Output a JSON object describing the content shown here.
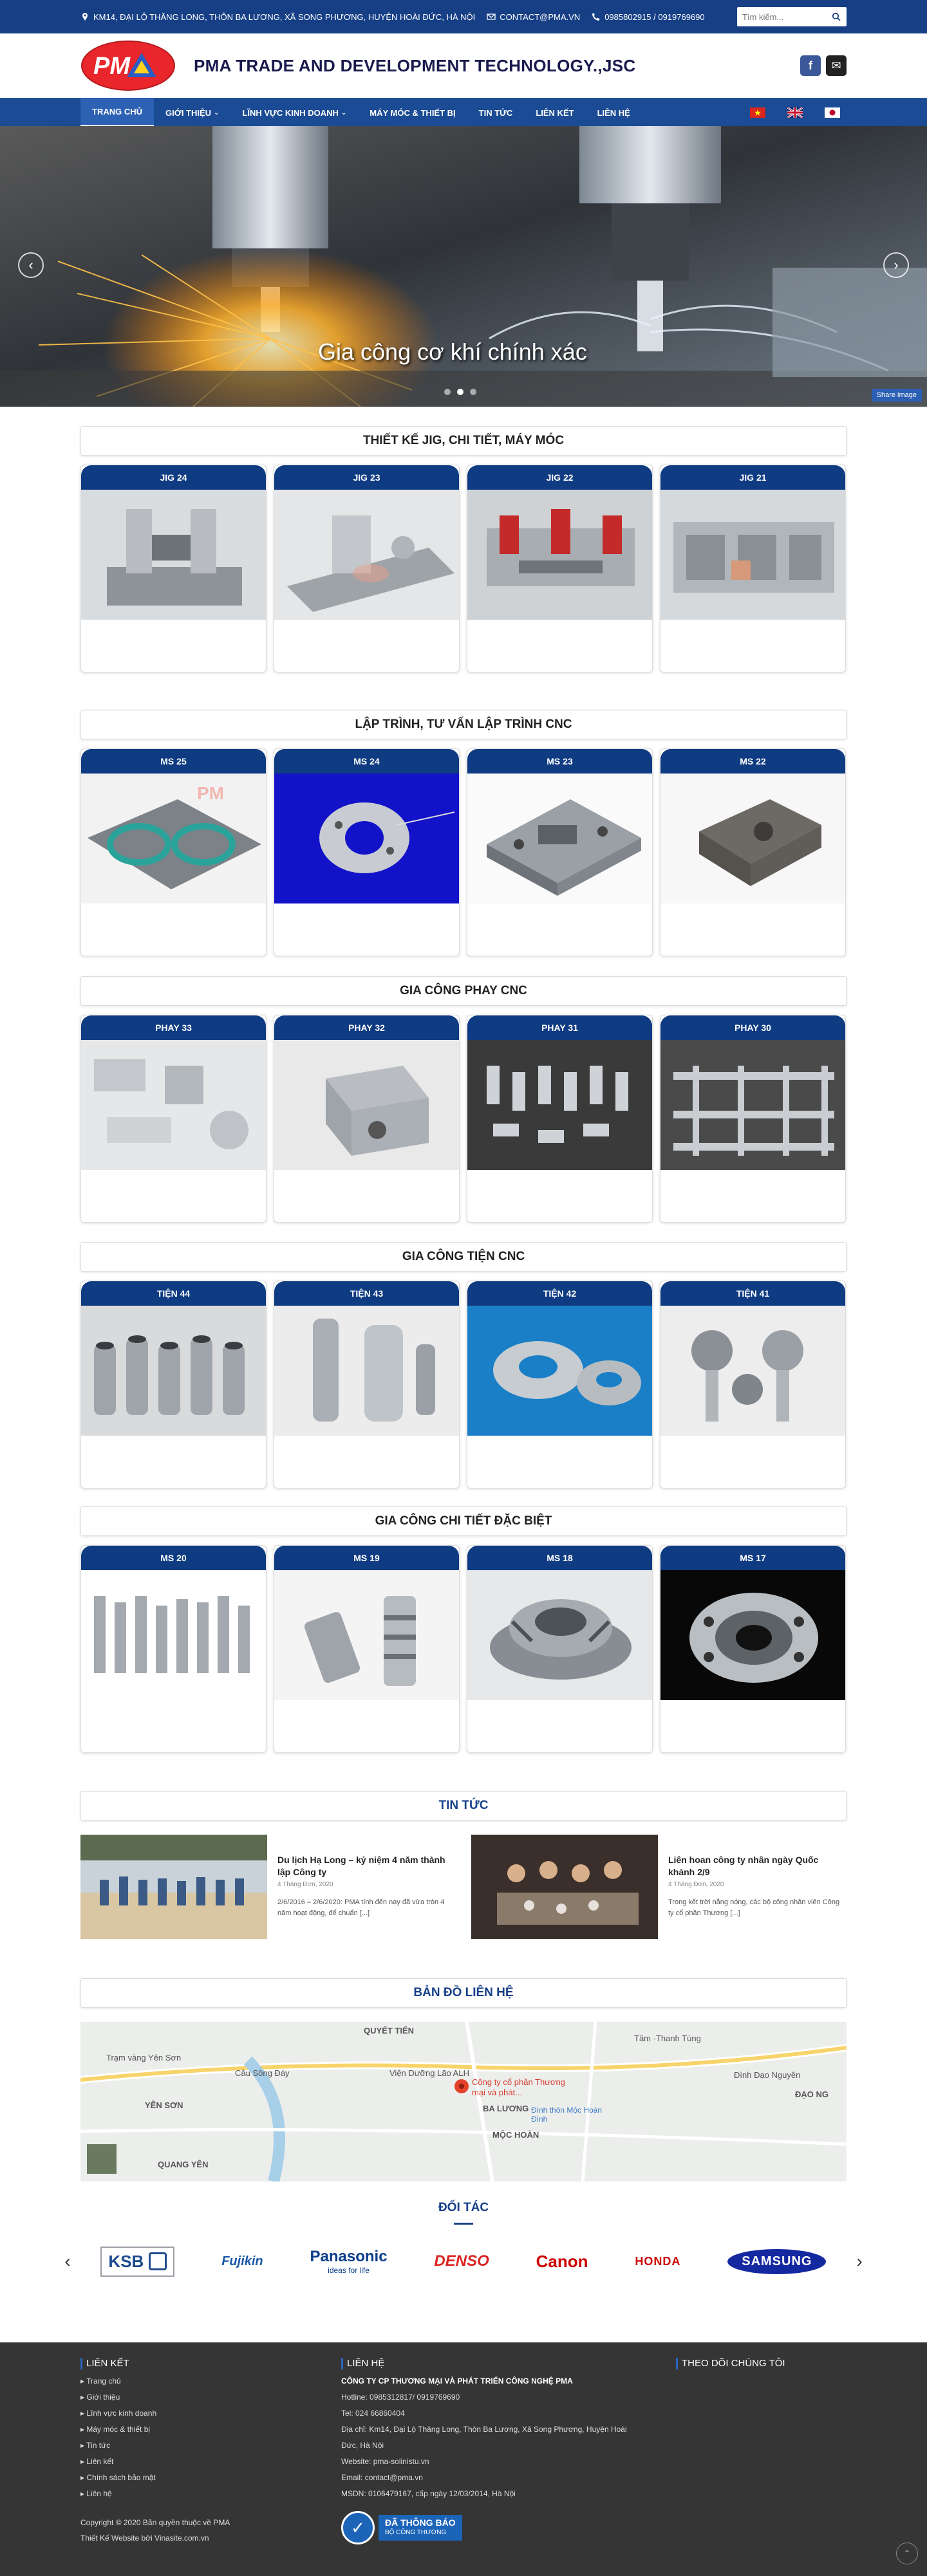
{
  "topbar": {
    "address": "KM14, ĐẠI LỘ THĂNG LONG, THÔN BA LƯƠNG, XÃ SONG PHƯƠNG, HUYỆN HOÀI ĐỨC, HÀ NỘI",
    "email": "CONTACT@PMA.VN",
    "phone": "0985802915 / 0919769690",
    "search_placeholder": "Tìm kiếm..."
  },
  "header": {
    "logo_text": "PMA",
    "company": "PMA TRADE AND DEVELOPMENT TECHNOLOGY.,JSC",
    "social": [
      "f",
      "✉"
    ]
  },
  "nav": {
    "items": [
      "TRANG CHỦ",
      "GIỚI THIỆU",
      "LĨNH VỰC KINH DOANH",
      "MÁY MÓC & THIẾT BỊ",
      "TIN TỨC",
      "LIÊN KẾT",
      "LIÊN HỆ"
    ]
  },
  "slider": {
    "caption": "Gia công cơ khí chính xác",
    "share": "Share image",
    "active_dot": 1,
    "dot_count": 3
  },
  "sections": [
    {
      "title": "THIẾT KẾ JIG, CHI TIẾT, MÁY MÓC",
      "cards": [
        "JIG 24",
        "JIG 23",
        "JIG 22",
        "JIG 21"
      ]
    },
    {
      "title": "LẬP TRÌNH, TƯ VẤN LẬP TRÌNH CNC",
      "cards": [
        "MS 25",
        "MS 24",
        "MS 23",
        "MS 22"
      ]
    },
    {
      "title": "GIA CÔNG PHAY CNC",
      "cards": [
        "PHAY 33",
        "PHAY 32",
        "PHAY 31",
        "PHAY 30"
      ]
    },
    {
      "title": "GIA CÔNG TIỆN CNC",
      "cards": [
        "TIỆN 44",
        "TIỆN 43",
        "TIỆN 42",
        "TIỆN 41"
      ]
    },
    {
      "title": "GIA CÔNG CHI TIẾT ĐẶC BIỆT",
      "cards": [
        "MS 20",
        "MS 19",
        "MS 18",
        "MS 17"
      ]
    }
  ],
  "news": {
    "title": "TIN TỨC",
    "items": [
      {
        "title": "Du lịch Hạ Long – kỷ niệm 4 năm thành lập Công ty",
        "date": "4 Tháng Đơn, 2020",
        "excerpt": "2/6/2016 – 2/6/2020: PMA tính đến nay đã vừa tròn 4 năm hoạt động, để chuẩn [...]"
      },
      {
        "title": "Liên hoan công ty nhân ngày Quốc khánh 2/9",
        "date": "4 Tháng Đơn, 2020",
        "excerpt": "Trong kết trời nắng nóng, các bộ công nhân viên Công ty cổ phần Thương [...]"
      }
    ]
  },
  "map": {
    "title": "BẢN ĐỒ LIÊN HỆ",
    "labels": [
      "Trạm vàng Yên Sơn",
      "Cầu Sông Đáy",
      "Viện Dưỡng Lão ALH",
      "Tâm -Thanh Tùng",
      "Đình Đạo Nguyên",
      "YÊN SƠN",
      "QUANG YÊN",
      "BA LƯƠNG",
      "MỘC HOÀN",
      "ĐẠO NG",
      "Đình thôn Mộc Hoàn Đình",
      "QUYẾT TIẾN"
    ],
    "pin": "Công ty cổ phần Thương mại và phát..."
  },
  "partners": {
    "title": "ĐỐI TÁC",
    "logos": [
      "KSB",
      "Fujikin",
      "Panasonic",
      "DENSO",
      "Canon",
      "HONDA",
      "SAMSUNG"
    ],
    "panasonic_tag": "ideas for life"
  },
  "footer": {
    "links_title": "LIÊN KẾT",
    "links": [
      "Trang chủ",
      "Giới thiệu",
      "Lĩnh vực kinh doanh",
      "Máy móc & thiết bị",
      "Tin tức",
      "Liên kết",
      "Chính sách bảo mật",
      "Liên hệ"
    ],
    "copyright": "Copyright © 2020 Bản quyền thuộc về PMA",
    "designer": "Thiết Kế Website bởi Vinasite.com.vn",
    "contact_title": "LIÊN HỆ",
    "contact_company": "CÔNG TY CP THƯƠNG MẠI VÀ PHÁT TRIỂN CÔNG NGHỆ PMA",
    "contact_lines": [
      "Hotline: 0985312817/ 0919769690",
      "Tel: 024 66860404",
      "Địa chỉ: Km14, Đại Lộ Thăng Long, Thôn Ba Lương, Xã Song Phương, Huyện Hoài",
      "Đức, Hà Nội",
      "Website: pma-solinistu.vn",
      "Email: contact@pma.vn",
      "MSDN: 0106479167, cấp ngày 12/03/2014, Hà Nội"
    ],
    "badge_main": "ĐÃ THÔNG BÁO",
    "badge_sub": "BỘ CÔNG THƯƠNG",
    "follow_title": "THEO DÕI CHÚNG TÔI"
  }
}
